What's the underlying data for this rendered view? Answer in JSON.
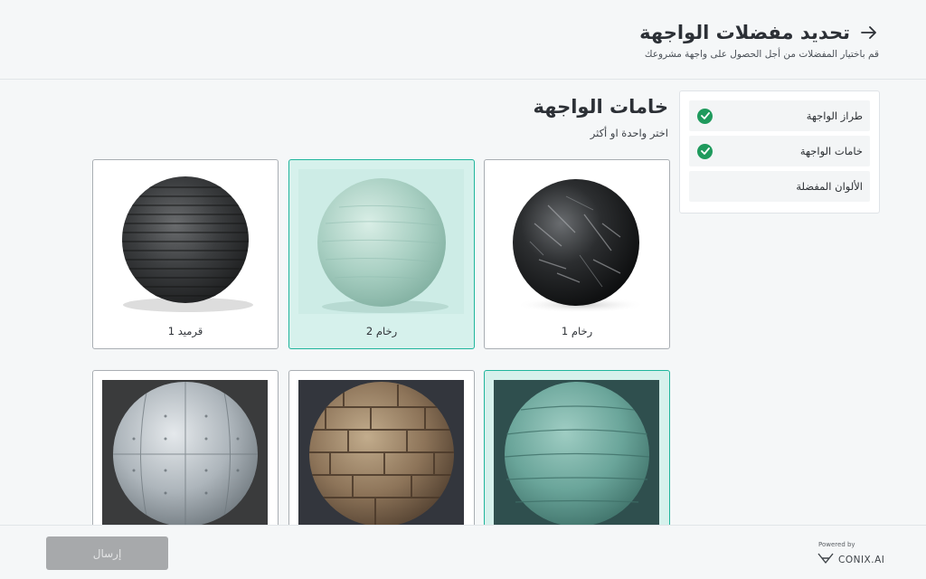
{
  "header": {
    "title": "تحديد مفضلات الواجهة",
    "subtitle": "قم باختيار المفضلات من أجل الحصول على واجهة مشروعك"
  },
  "steps": [
    {
      "label": "طراز الواجهة",
      "completed": true
    },
    {
      "label": "خامات الواجهة",
      "completed": true
    },
    {
      "label": "الألوان المفضلة",
      "completed": false
    }
  ],
  "section": {
    "title": "خامات الواجهة",
    "subtitle": "اختر واحدة او أكثر"
  },
  "materials": [
    {
      "label": "رخام 1",
      "selected": false,
      "icon": "black-marble-sphere"
    },
    {
      "label": "رخام 2",
      "selected": true,
      "icon": "green-marble-sphere"
    },
    {
      "label": "قرميد 1",
      "selected": false,
      "icon": "dark-brick-sphere"
    },
    {
      "label": "",
      "selected": true,
      "icon": "teal-concrete-sphere"
    },
    {
      "label": "",
      "selected": false,
      "icon": "stone-block-sphere"
    },
    {
      "label": "",
      "selected": false,
      "icon": "grey-concrete-panel-sphere"
    }
  ],
  "footer": {
    "submit_label": "إرسال",
    "powered_by": "Powered by",
    "brand": "CONIX.AI"
  },
  "colors": {
    "accent": "#20b59c",
    "check": "#1f9a5d",
    "disabled_button": "#a7a9ab"
  }
}
